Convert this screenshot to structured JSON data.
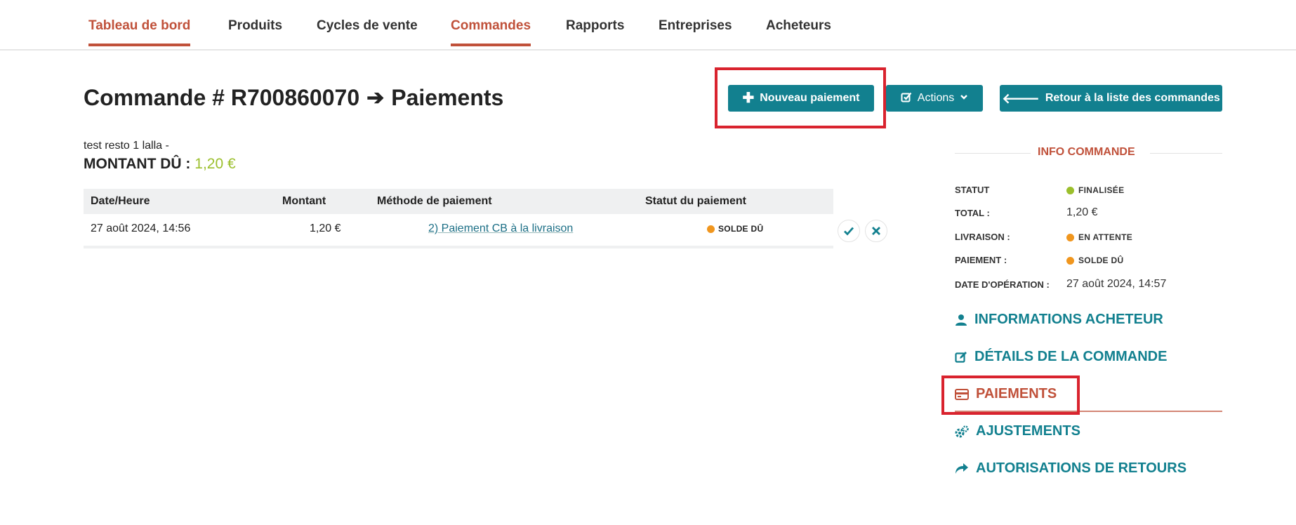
{
  "nav": {
    "items": [
      {
        "label": "Tableau de bord",
        "active": true
      },
      {
        "label": "Produits",
        "active": false
      },
      {
        "label": "Cycles de vente",
        "active": false
      },
      {
        "label": "Commandes",
        "active": true
      },
      {
        "label": "Rapports",
        "active": false
      },
      {
        "label": "Entreprises",
        "active": false
      },
      {
        "label": "Acheteurs",
        "active": false
      }
    ]
  },
  "header": {
    "order_prefix": "Commande # R700860070",
    "arrow": "➔",
    "section": "Paiements",
    "buttons": {
      "new_payment": "Nouveau paiement",
      "actions": "Actions",
      "back": "Retour à la liste des commandes"
    }
  },
  "order": {
    "customer": "test resto 1 lalla -",
    "due_label": "MONTANT DÛ :",
    "due_amount": "1,20 €"
  },
  "table": {
    "columns": [
      "Date/Heure",
      "Montant",
      "Méthode de paiement",
      "Statut du paiement"
    ],
    "rows": [
      {
        "datetime": "27 août 2024, 14:56",
        "amount": "1,20 €",
        "method": "2) Paiement CB à la livraison",
        "status": "SOLDE DÛ"
      }
    ]
  },
  "info": {
    "title": "INFO COMMANDE",
    "rows": [
      {
        "label": "STATUT",
        "value": "FINALISÉE",
        "dot_color": "#9bbf2c"
      },
      {
        "label": "TOTAL :",
        "value": "1,20 €"
      },
      {
        "label": "LIVRAISON :",
        "value": "EN ATTENTE",
        "dot_color": "#f0961e"
      },
      {
        "label": "PAIEMENT :",
        "value": "SOLDE DÛ",
        "dot_color": "#f0961e"
      },
      {
        "label": "DATE D'OPÉRATION :",
        "value": "27 août 2024, 14:57"
      }
    ]
  },
  "sidebar": {
    "links": [
      {
        "label": "INFORMATIONS ACHETEUR",
        "icon": "user-icon",
        "active": false
      },
      {
        "label": "DÉTAILS DE LA COMMANDE",
        "icon": "edit-icon",
        "active": false
      },
      {
        "label": "PAIEMENTS",
        "icon": "credit-card-icon",
        "active": true
      },
      {
        "label": "AJUSTEMENTS",
        "icon": "gears-icon",
        "active": false
      },
      {
        "label": "AUTORISATIONS DE RETOURS",
        "icon": "share-icon",
        "active": false
      }
    ]
  },
  "colors": {
    "accent": "#12808f",
    "brand": "#c0513a",
    "success": "#9bbf2c",
    "warning": "#f0961e",
    "highlight": "#d9232e"
  }
}
